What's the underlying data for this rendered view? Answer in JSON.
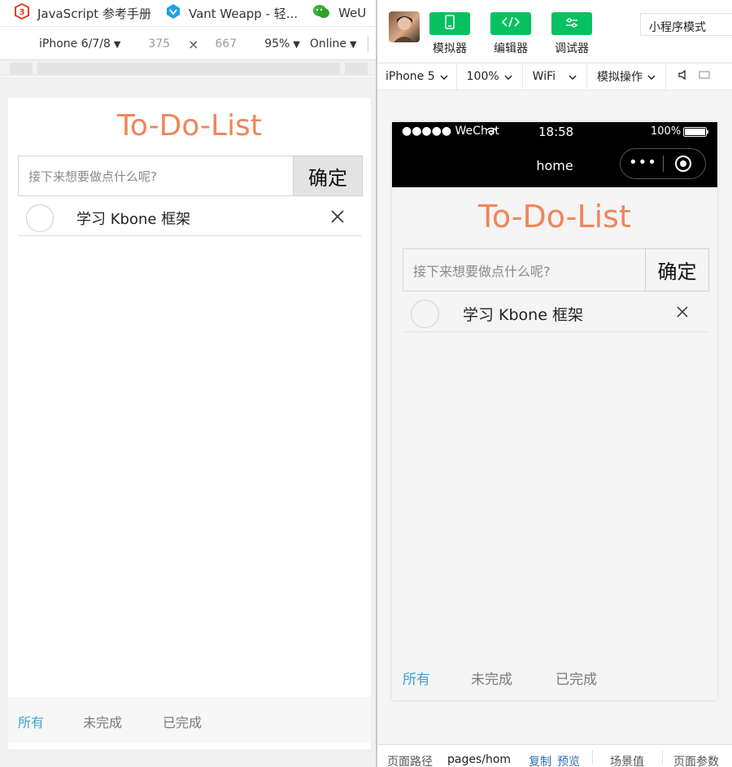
{
  "left_browser": {
    "bookmarks": [
      {
        "label": "JavaScript 参考手册",
        "icon": "javascript-reference-icon"
      },
      {
        "label": "Vant Weapp - 轻...",
        "icon": "vant-weapp-icon"
      },
      {
        "label": "WeU",
        "icon": "wechat-icon"
      }
    ],
    "devices_toolbar": {
      "device": "iPhone 6/7/8",
      "width": "375",
      "times": "×",
      "height": "667",
      "zoom": "95%",
      "network": "Online"
    }
  },
  "todo_left": {
    "title": "To-Do-List",
    "input_placeholder": "接下来想要做点什么呢?",
    "confirm_label": "确定",
    "items": [
      {
        "text": "学习 Kbone 框架"
      }
    ],
    "filters": [
      "所有",
      "未完成",
      "已完成"
    ],
    "active_filter": "所有"
  },
  "wechat_devtools": {
    "toolbar": {
      "simulator_label": "模拟器",
      "editor_label": "编辑器",
      "debugger_label": "调试器",
      "mode": "小程序模式"
    },
    "devbar": {
      "device": "iPhone 5",
      "zoom": "100%",
      "network": "WiFi",
      "operations": "模拟操作"
    },
    "phone": {
      "status_left": "●●●●● WeChat",
      "time": "18:58",
      "battery": "100%",
      "nav_title": "home",
      "capsule_more": "•••"
    },
    "bottom_bar": {
      "path_label": "页面路径",
      "path_value": "pages/hom",
      "copy": "复制",
      "preview": "预览",
      "scene": "场景值",
      "params": "页面参数"
    }
  },
  "todo_right": {
    "title": "To-Do-List",
    "input_placeholder": "接下来想要做点什么呢?",
    "confirm_label": "确定",
    "items": [
      {
        "text": "学习 Kbone 框架"
      }
    ],
    "filters": [
      "所有",
      "未完成",
      "已完成"
    ],
    "active_filter": "所有"
  },
  "colors": {
    "title_accent": "#f0855b",
    "active_filter": "#3aa3d8",
    "wechat_green": "#07c160"
  }
}
